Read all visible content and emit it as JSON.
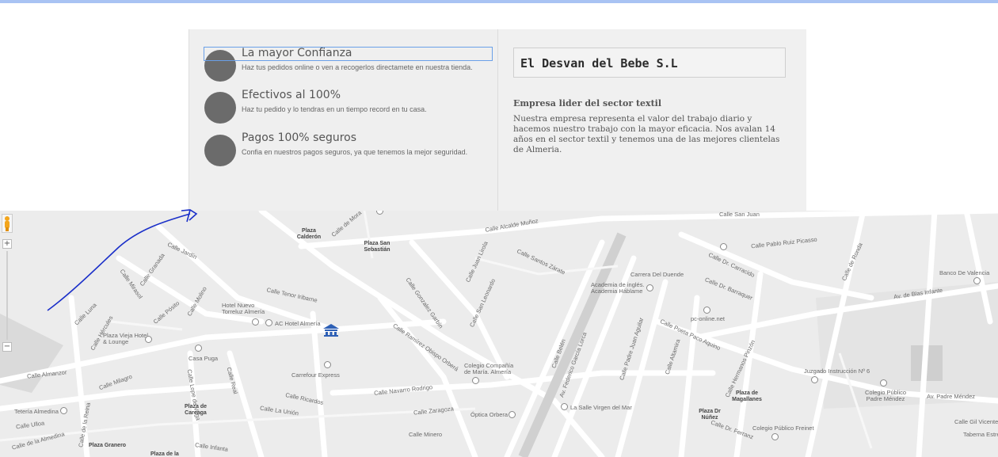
{
  "features": [
    {
      "title": "La mayor Confianza",
      "desc": "Haz tus pedidos online o ven a recogerlos directamete en nuestra tienda."
    },
    {
      "title": "Efectivos al 100%",
      "desc": "Haz tu pedido y lo tendras en un tiempo record en tu casa."
    },
    {
      "title": "Pagos 100% seguros",
      "desc": "Confia en nuestros pagos seguros, ya que tenemos la mejor seguridad."
    }
  ],
  "company": {
    "name": "El Desvan del Bebe S.L",
    "about_title": "Empresa lider del sector textil",
    "about_text": "Nuestra empresa representa el valor del trabajo diario y hacemos nuestro trabajo con la mayor eficacia. Nos avalan 14 años en el sector textil y tenemos una de las mejores clientelas de Almeria."
  },
  "map": {
    "zoom_in": "+",
    "zoom_out": "−",
    "labels": [
      "Calle Alcalde Muñoz",
      "Calle San Juan",
      "Calle Pablo Ruiz Picasso",
      "Calle Dr. Carracido",
      "Calle de Ronda",
      "Banco De Valencia",
      "Av. de Blas Infante",
      "Calle Santos Zárate",
      "Carrera Del Duende",
      "Academia de inglés. Academia Háblame",
      "Calle Dr. Barraquer",
      "pc-online.net",
      "Calle Poeta Paco Aquino",
      "Calle Hermanos Pinzón",
      "Juzgado Instrucción Nº 6",
      "Colegio Público Padre Méndez",
      "Av. Padre Méndez",
      "Calle Gil Vicente",
      "Taberna Estrecho",
      "Plaza de Magallanes",
      "Plaza Dr Núñez",
      "Calle Dr. Ferranz",
      "Colegio Público Freinet",
      "La Salle Virgen del Mar",
      "Óptica Orbera",
      "Calle Minero",
      "Calle Zaragoza",
      "Calle Navarro Rodrigo",
      "Colegio Compañía de María. Almería",
      "Carrefour Express",
      "Calle La Unión",
      "Calle Ricardos",
      "AC Hotel Almería",
      "Hotel Nuevo Torreluz Almería",
      "Calle Tenor Iribarne",
      "Plaza San Sebastián",
      "Plaza Calderón",
      "Calle Jardín",
      "Plaza Vieja Hotel & Lounge",
      "Casa Puga",
      "Calle Almanzor",
      "Calle Milagro",
      "Tetería Almedina",
      "Calle Ulloa",
      "Calle de la Almedina",
      "Plaza de Careaga",
      "Plaza Granero",
      "Plaza de la",
      "Calle Infanta",
      "Calle de la Reina",
      "Calle Lope de Vega",
      "Calle Real",
      "Calle Juan Lirola",
      "Calle San Leonardo",
      "Calle Gonzalez Garbín",
      "Calle Ramírez Obispo Orberá",
      "Av. Federico García Lorca",
      "Calle Padre Juan Aguilar",
      "Calle Altamira",
      "Calle Belén",
      "Calle Luna",
      "Calle Hércules",
      "Calle Mirasol",
      "Calle Pósito",
      "Calle Molino",
      "Calle Granada",
      "Calle de Mora"
    ]
  }
}
